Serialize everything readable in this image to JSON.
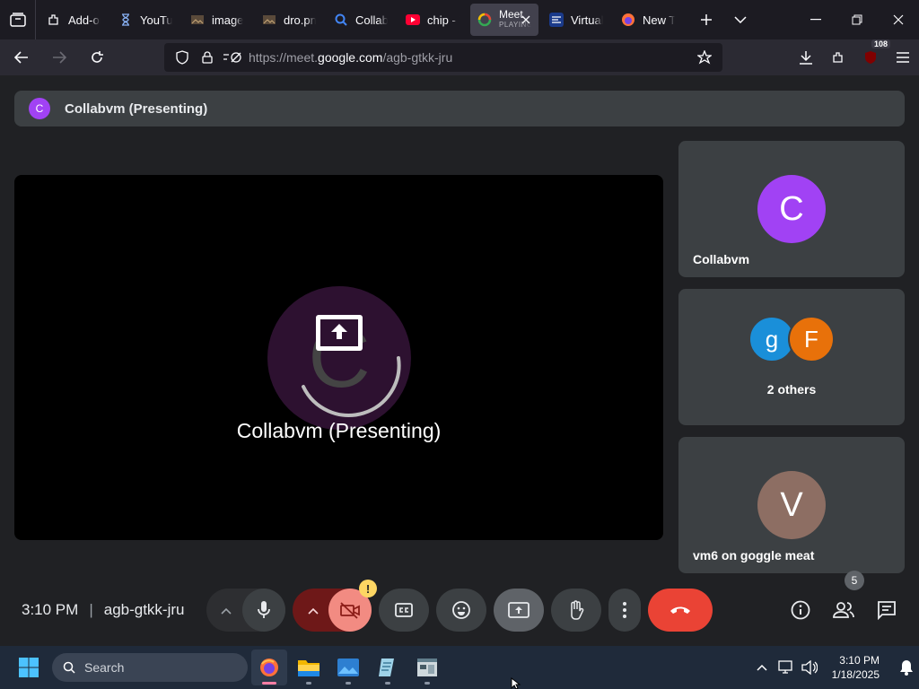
{
  "browser": {
    "tabs": [
      {
        "title": "Add-ons",
        "icon": "puzzle-icon"
      },
      {
        "title": "YouTube",
        "icon": "hourglass-icon"
      },
      {
        "title": "image",
        "icon": "image-file-icon"
      },
      {
        "title": "dro.png",
        "icon": "image-file-icon"
      },
      {
        "title": "Collabvm",
        "icon": "magnifier-icon"
      },
      {
        "title": "chip - YouTube",
        "icon": "youtube-icon"
      },
      {
        "title": "Meet",
        "subtitle": "PLAYING",
        "icon": "google-meet-icon",
        "active": true
      },
      {
        "title": "Virtual",
        "icon": "virtual-icon"
      },
      {
        "title": "New Tab",
        "icon": "firefox-icon"
      }
    ],
    "url_prefix": "https://meet.",
    "url_domain": "google.com",
    "url_path": "/agb-gtkk-jru",
    "extension_badge": "108"
  },
  "meet": {
    "presenting_avatar": "C",
    "presenting_label": "Collabvm (Presenting)",
    "stage_name": "Collabvm (Presenting)",
    "stage_avatar": "C",
    "tiles": [
      {
        "avatar": "C",
        "name": "Collabvm",
        "color": "#a142f4"
      },
      {
        "avatars": [
          "g",
          "F"
        ],
        "name": "2 others",
        "colors": [
          "#1a8fd9",
          "#e8710a"
        ]
      },
      {
        "avatar": "V",
        "name": "vm6 on goggle meat",
        "color": "#8d6e63"
      }
    ],
    "time": "3:10 PM",
    "meeting_code": "agb-gtkk-jru",
    "people_count": "5",
    "camera_warning": "!"
  },
  "taskbar": {
    "search_placeholder": "Search",
    "time": "3:10 PM",
    "date": "1/18/2025"
  },
  "colors": {
    "leave_red": "#ea4335",
    "camera_off_bg": "#f28b82",
    "camera_off_dark": "#6e1818"
  }
}
